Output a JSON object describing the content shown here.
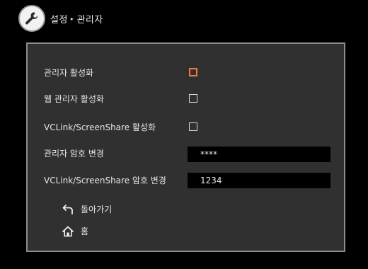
{
  "header": {
    "icon": "wrench-icon",
    "breadcrumb": [
      "설정",
      "관리자"
    ],
    "separator": "▸"
  },
  "settings": [
    {
      "label": "관리자 활성화",
      "type": "checkbox",
      "checked": false,
      "focused": true
    },
    {
      "label": "웹 관리자 활성화",
      "type": "checkbox",
      "checked": false,
      "focused": false
    },
    {
      "label": "VCLink/ScreenShare 활성화",
      "type": "checkbox",
      "checked": false,
      "focused": false
    },
    {
      "label": "관리자 암호 변경",
      "type": "text",
      "value": "****"
    },
    {
      "label": "VCLink/ScreenShare 암호 변경",
      "type": "text",
      "value": "1234"
    }
  ],
  "nav": {
    "back": {
      "label": "돌아가기",
      "icon": "return-arrow-icon"
    },
    "home": {
      "label": "홈",
      "icon": "home-icon"
    }
  },
  "colors": {
    "background": "#000000",
    "panel": "#303030",
    "panel_border": "#8c8c8c",
    "focus": "#f07a3c",
    "text": "#e6e6e6"
  }
}
